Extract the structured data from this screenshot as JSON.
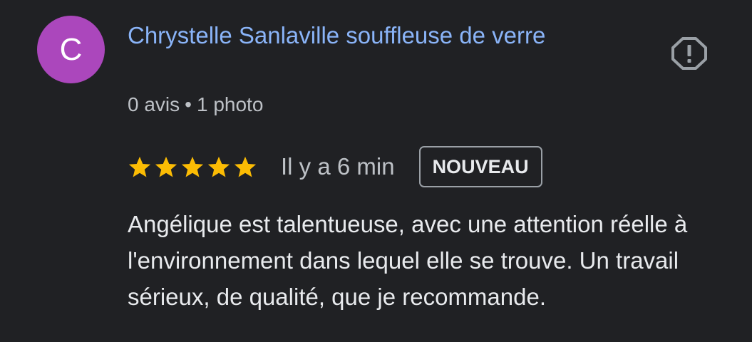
{
  "author": {
    "initial": "C",
    "name": "Chrystelle Sanlaville souffleuse de verre",
    "avatar_color": "#ab47bc",
    "name_color": "#8ab4f8"
  },
  "meta": {
    "reviews": "0 avis",
    "separator": "•",
    "photos": "1 photo"
  },
  "report_icon": "alert-octagon-icon",
  "rating": {
    "stars": 5,
    "max_stars": 5,
    "star_color": "#fbbc04"
  },
  "time": "Il y a 6 min",
  "badge": "NOUVEAU",
  "review_text": "Angélique est talentueuse, avec une attention réelle à l'environnement dans lequel elle se trouve. Un travail sérieux, de qualité, que je recommande."
}
